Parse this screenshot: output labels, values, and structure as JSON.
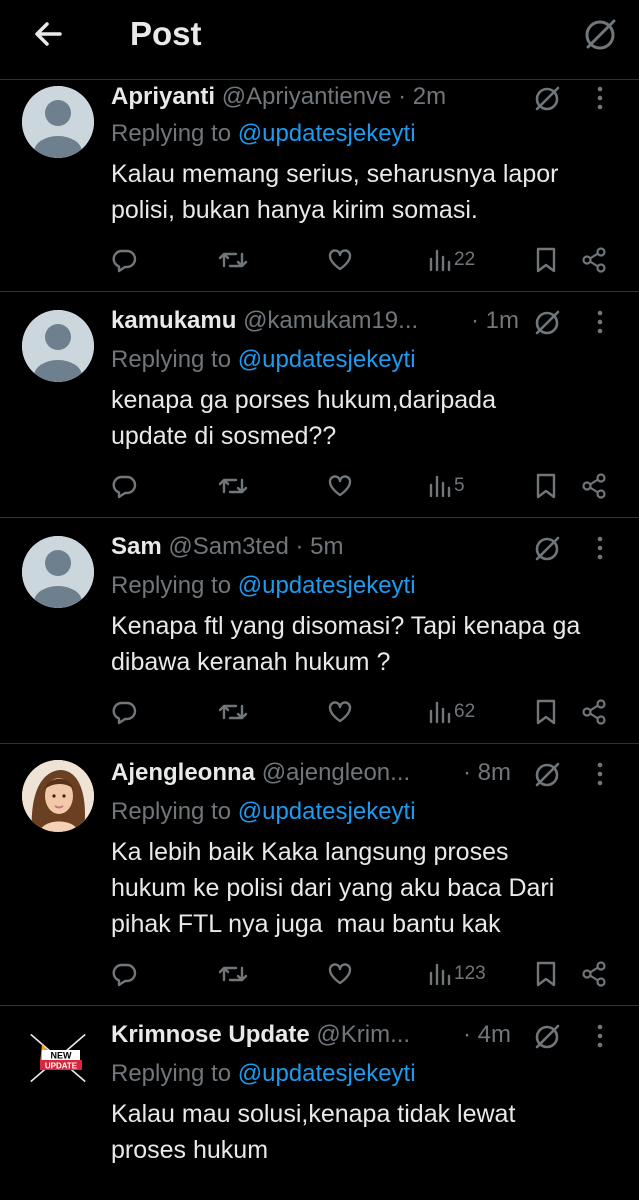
{
  "header": {
    "title": "Post"
  },
  "tweets": [
    {
      "name": "Apriyanti",
      "handle": "@Apriyantienve",
      "time": "· 2m",
      "replying_prefix": "Replying to ",
      "replying_to": "@updatesjekeyti",
      "text": "Kalau memang serius, seharusnya lapor\npolisi, bukan hanya kirim somasi.",
      "views": "22",
      "avatar": "default"
    },
    {
      "name": "kamukamu",
      "handle": "@kamukam19...",
      "time": "· 1m",
      "replying_prefix": "Replying to ",
      "replying_to": "@updatesjekeyti",
      "text": "kenapa ga porses hukum,daripada\nupdate di sosmed??",
      "views": "5",
      "avatar": "default"
    },
    {
      "name": "Sam",
      "handle": "@Sam3ted",
      "time": "· 5m",
      "replying_prefix": "Replying to ",
      "replying_to": "@updatesjekeyti",
      "text": "Kenapa ftl yang disomasi? Tapi kenapa ga\ndibawa keranah hukum ?",
      "views": "62",
      "avatar": "default"
    },
    {
      "name": "Ajengleonna",
      "handle": "@ajengleon...",
      "time": "· 8m",
      "replying_prefix": "Replying to ",
      "replying_to": "@updatesjekeyti",
      "text": "Ka lebih baik Kaka langsung proses\nhukum ke polisi dari yang aku baca Dari\npihak FTL nya juga  mau bantu kak",
      "views": "123",
      "avatar": "photo"
    },
    {
      "name": "Krimnose Update",
      "handle": "@Krim...",
      "time": "· 4m",
      "replying_prefix": "Replying to ",
      "replying_to": "@updatesjekeyti",
      "text": "Kalau mau solusi,kenapa tidak lewat\nproses hukum",
      "views": "",
      "avatar": "new-update-logo",
      "logo_text": [
        "NEW",
        "UPDATE"
      ]
    }
  ],
  "icons": {
    "back": "arrow-left-icon",
    "grok": "grok-icon",
    "more": "more-vertical-icon",
    "reply": "reply-icon",
    "repost": "repost-icon",
    "like": "heart-icon",
    "views": "views-icon",
    "bookmark": "bookmark-icon",
    "share": "share-icon"
  },
  "colors": {
    "background": "#000000",
    "text": "#e7e9ea",
    "muted": "#71767b",
    "accent": "#1d9bf0",
    "divider": "#2f3336"
  }
}
